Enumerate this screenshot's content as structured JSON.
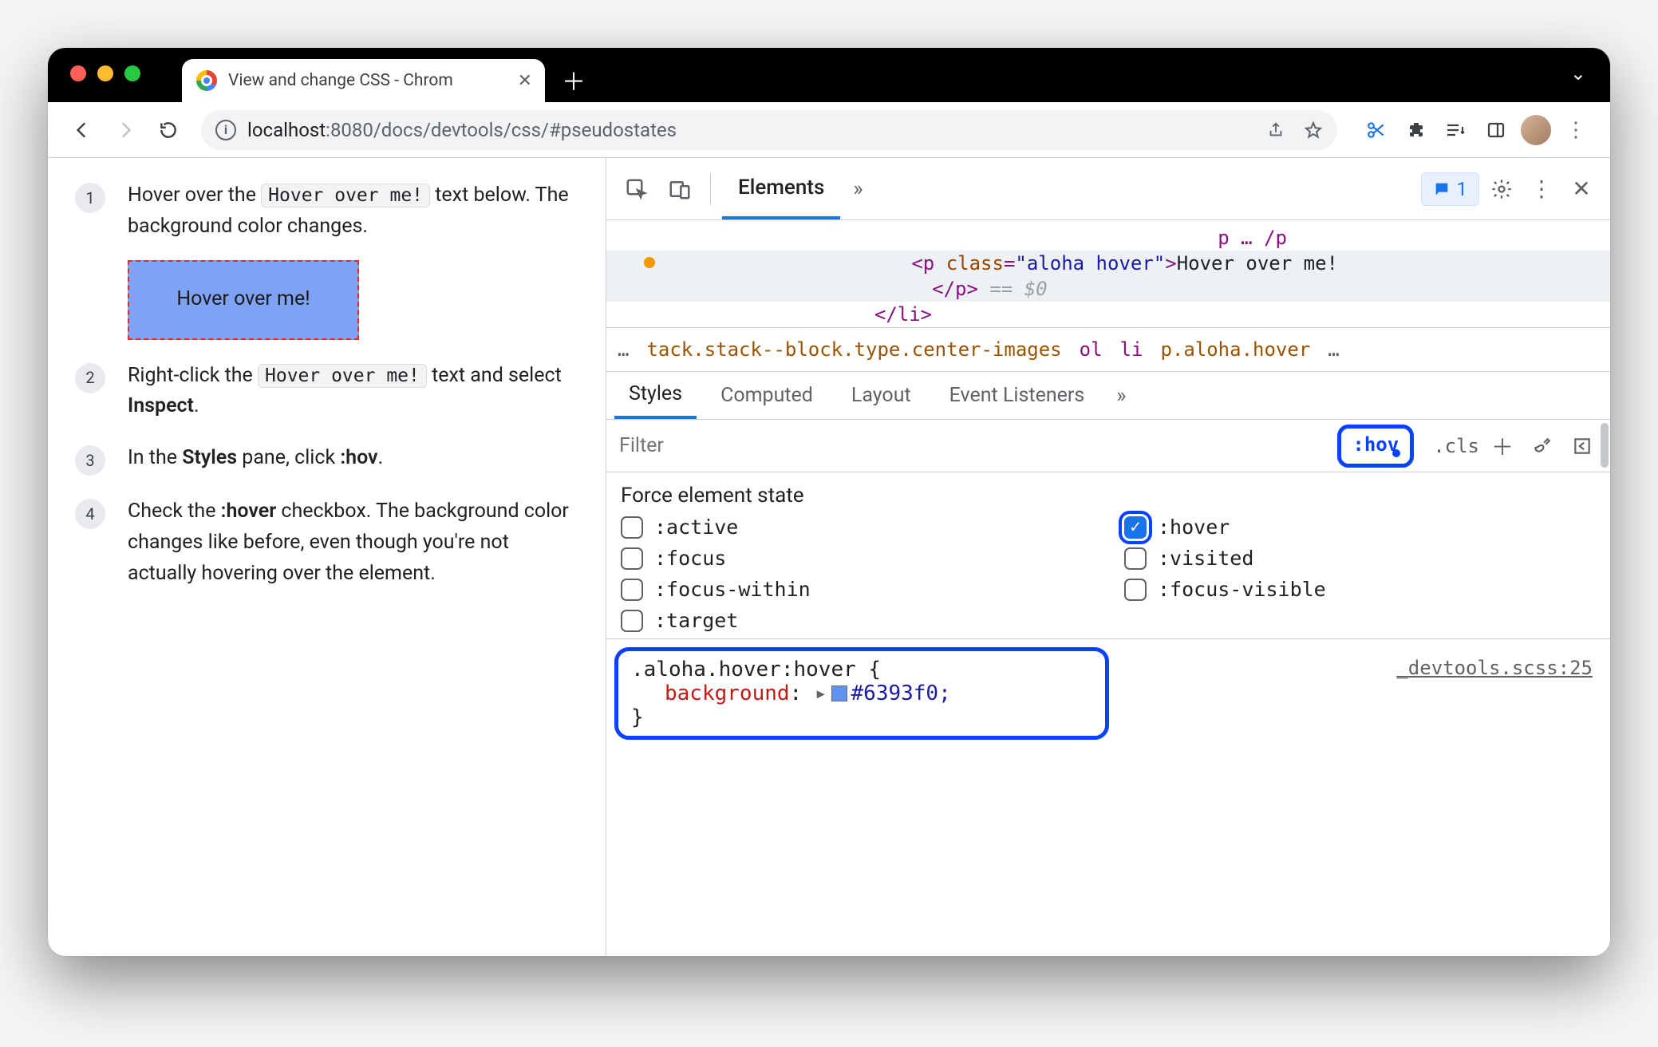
{
  "window": {
    "tab_title": "View and change CSS - Chrom",
    "traffic": [
      "close",
      "minimize",
      "zoom"
    ]
  },
  "toolbar": {
    "back": "←",
    "forward": "→",
    "reload": "⟳",
    "url_host": "localhost",
    "url_port": ":8080",
    "url_path": "/docs/devtools/css/#pseudostates",
    "share": "⇧",
    "star": "☆",
    "scissors": "✂",
    "ext": "✦",
    "playlist": "≡♪",
    "panel": "◨",
    "menu": "⋮"
  },
  "page": {
    "steps": [
      {
        "n": "1",
        "pre": "Hover over the ",
        "code": "Hover over me!",
        "post": " text below. The background color changes."
      },
      {
        "n": "2",
        "pre": "Right-click the ",
        "code": "Hover over me!",
        "post": " text and select ",
        "bold": "Inspect",
        "tail": "."
      },
      {
        "n": "3",
        "text": "In the ",
        "bold": "Styles",
        "mid": " pane, click ",
        "bold2": ":hov",
        "tail": "."
      },
      {
        "n": "4",
        "text": "Check the ",
        "bold": ":hover",
        "mid": " checkbox. The background color changes like before, even though you're not actually hovering over the element."
      }
    ],
    "hover_card": "Hover over me!"
  },
  "devtools": {
    "tabs": {
      "elements": "Elements"
    },
    "issues_count": "1",
    "dom": {
      "open_tag_pre": "<p ",
      "class_attr": "class",
      "class_val": "\"aloha hover\"",
      "text": "Hover over me!",
      "close": "</p>",
      "eq0": " == $0",
      "prev": "p … /p",
      "next": "</li>"
    },
    "crumbs": {
      "long": "tack.stack--block.type.center-images",
      "ol": "ol",
      "li": "li",
      "sel": "p.aloha.hover"
    },
    "stabs": {
      "styles": "Styles",
      "computed": "Computed",
      "layout": "Layout",
      "listeners": "Event Listeners"
    },
    "filter_placeholder": "Filter",
    "hov_label": ":hov",
    "cls_label": ".cls",
    "force_title": "Force element state",
    "states": {
      "active": ":active",
      "hover": ":hover",
      "focus": ":focus",
      "visited": ":visited",
      "focuswithin": ":focus-within",
      "focusvisible": ":focus-visible",
      "target": ":target"
    },
    "rule": {
      "selector": ".aloha.hover:hover {",
      "prop": "background",
      "value": "#6393f0;",
      "close": "}",
      "source": "_devtools.scss:25"
    }
  }
}
